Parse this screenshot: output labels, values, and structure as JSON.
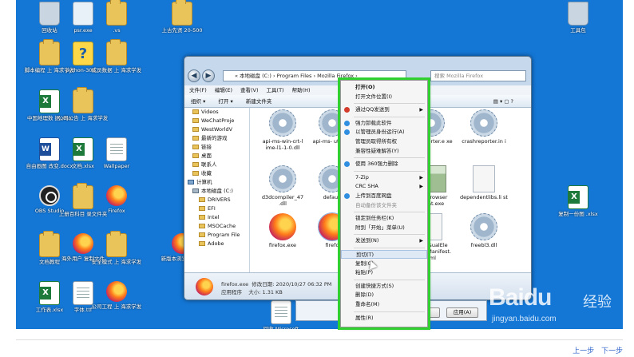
{
  "desktop_icons": [
    {
      "label": "回收站",
      "kind": "recycle"
    },
    {
      "label": "psr.exe",
      "kind": "img"
    },
    {
      "label": ".vs",
      "kind": "folder"
    },
    {
      "label": "上古先贤 20-500",
      "kind": "folder"
    },
    {
      "label": "工具包",
      "kind": "recycle"
    },
    {
      "label": "脚本编程 上 海求学发",
      "kind": "folder"
    },
    {
      "label": "python-306...",
      "kind": "python"
    },
    {
      "label": "成员数据 上 海求学发",
      "kind": "folder"
    },
    {
      "label": "中国地理数 据.xlsx",
      "kind": "excel"
    },
    {
      "label": "公司公告 上 海求学发",
      "kind": "folder"
    },
    {
      "label": "自由画图 改变.docx",
      "kind": "word"
    },
    {
      "label": "文档.xlsx",
      "kind": "excel"
    },
    {
      "label": "Wallpaper",
      "kind": "doc"
    },
    {
      "label": "OBS Studio",
      "kind": "obs"
    },
    {
      "label": "上册百科目 录文件夹",
      "kind": "folder"
    },
    {
      "label": "Firefox",
      "kind": "firefox"
    },
    {
      "label": "复制一份图 .xlsx",
      "kind": "excel"
    },
    {
      "label": "文档教程",
      "kind": "folder"
    },
    {
      "label": "海外用户 复制文件",
      "kind": "firefox"
    },
    {
      "label": "安全模式 上 海求学发",
      "kind": "folder"
    },
    {
      "label": "新版本浏览 器.lnk",
      "kind": "firefox"
    },
    {
      "label": "工作表.xlsx",
      "kind": "excel"
    },
    {
      "label": "字体.ttf",
      "kind": "doc"
    },
    {
      "label": "公司工程 上 海求学发",
      "kind": "firefox"
    },
    {
      "label": "回收 Microsoft",
      "kind": "doc"
    }
  ],
  "explorer": {
    "address": "« 本地磁盘 (C:) › Program Files › Mozilla Firefox ›",
    "search_placeholder": "搜索 Mozilla Firefox",
    "menu": [
      "文件(F)",
      "编辑(E)",
      "查看(V)",
      "工具(T)",
      "帮助(H)"
    ],
    "toolbar": [
      "组织 ▾",
      "打开 ▾",
      "新建文件夹"
    ],
    "nav": [
      {
        "label": "Videos",
        "kind": "folder"
      },
      {
        "label": "WeChatProje",
        "kind": "folder"
      },
      {
        "label": "WestWorldV",
        "kind": "folder"
      },
      {
        "label": "最新的游戏",
        "kind": "folder"
      },
      {
        "label": "链接",
        "kind": "folder"
      },
      {
        "label": "桌面",
        "kind": "folder"
      },
      {
        "label": "联系人",
        "kind": "folder"
      },
      {
        "label": "收藏",
        "kind": "folder"
      },
      {
        "label": "计算机",
        "kind": "pc"
      },
      {
        "label": "本地磁盘 (C:)",
        "kind": "drv"
      },
      {
        "label": "DRIVERS",
        "kind": "folder"
      },
      {
        "label": "EFI",
        "kind": "folder"
      },
      {
        "label": "Intel",
        "kind": "folder"
      },
      {
        "label": "MSOCache",
        "kind": "folder"
      },
      {
        "label": "Program File",
        "kind": "folder"
      },
      {
        "label": "Adobe",
        "kind": "folder"
      }
    ],
    "files": [
      {
        "label": "api-ms-win-crt-l ime-l1-1-0.dll",
        "kind": "gear"
      },
      {
        "label": "api-ms- utility-l",
        "kind": "gear"
      },
      {
        "label": "ashreporter.e xe",
        "kind": "gear"
      },
      {
        "label": "crashreporter.in i",
        "kind": "gear"
      },
      {
        "label": "d3dcompiler_47 .dll",
        "kind": "gear"
      },
      {
        "label": "default",
        "kind": "gear"
      },
      {
        "label": "ault-browser agent.exe",
        "kind": "screen"
      },
      {
        "label": "dependentlibs.li st",
        "kind": "blank"
      },
      {
        "label": "firefox.exe",
        "kind": "fox"
      },
      {
        "label": "firefo",
        "kind": "fox"
      },
      {
        "label": "fox.VisualEle mentsManifest. xml",
        "kind": "blank"
      },
      {
        "label": "freebl3.dll",
        "kind": "gear"
      }
    ],
    "status_name": "firefox.exe",
    "status_modified": "修改日期: 2020/10/27 06:32 PM",
    "status_type": "应用程序",
    "status_size": "大小: 1.31 KB"
  },
  "dialog_buttons": [
    "取消",
    "应用(A)"
  ],
  "context_menu": [
    {
      "label": "打开(O)",
      "bold": true
    },
    {
      "label": "打开文件位置(I)"
    },
    {
      "sep": true
    },
    {
      "label": "通过QQ发送到",
      "arrow": true,
      "icon": "#d43b2a"
    },
    {
      "sep": true
    },
    {
      "label": "强力卸载此软件",
      "icon": "#2f8ee0"
    },
    {
      "label": "以管理员身份运行(A)",
      "icon": "#2f8ee0"
    },
    {
      "label": "管理员取得所有权"
    },
    {
      "label": "兼容性疑难解答(Y)"
    },
    {
      "sep": true
    },
    {
      "label": "使用 360强力删除",
      "icon": "#2f8ee0"
    },
    {
      "sep": true
    },
    {
      "label": "7-Zip",
      "arrow": true
    },
    {
      "label": "CRC SHA",
      "arrow": true
    },
    {
      "label": "上传到百度网盘",
      "icon": "#2f8ee0"
    },
    {
      "label": "自动备份该文件夹",
      "dim": true
    },
    {
      "sep": true
    },
    {
      "label": "锁定到任务栏(K)"
    },
    {
      "label": "附到「开始」菜单(U)"
    },
    {
      "sep": true
    },
    {
      "label": "发送到(N)",
      "arrow": true
    },
    {
      "sep": true
    },
    {
      "label": "剪切(T)",
      "hover": true
    },
    {
      "label": "复制(C)"
    },
    {
      "label": "粘贴(P)"
    },
    {
      "sep": true
    },
    {
      "label": "创建快捷方式(S)"
    },
    {
      "label": "删除(D)"
    },
    {
      "label": "重命名(M)"
    },
    {
      "sep": true
    },
    {
      "label": "属性(R)"
    }
  ],
  "watermark": {
    "brand": "Bai",
    "paw": "du",
    "cn": "经验",
    "url": "jingyan.baidu.com"
  },
  "pager": {
    "prev": "上一步",
    "next": "下一步"
  },
  "colors": {
    "desktop": "#1477d6",
    "highlight": "#2fd02f"
  }
}
